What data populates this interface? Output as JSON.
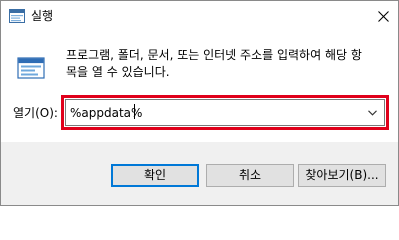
{
  "window": {
    "title": "실행",
    "app_icon": "run-dialog-icon",
    "close_icon": "close-icon"
  },
  "dialog": {
    "icon": "run-icon",
    "description_line1": "프로그램, 폴더, 문서, 또는 인터넷 주소를 입력하여 해당 항",
    "description_line2": "목을 열 수 있습니다.",
    "open_label": "열기(O):",
    "open_value": "%appdata%",
    "dropdown_icon": "chevron-down-icon",
    "highlight_color": "#e0001b"
  },
  "buttons": {
    "ok": "확인",
    "cancel": "취소",
    "browse": "찾아보기(B)..."
  },
  "colors": {
    "footer_bg": "#f0f0f0",
    "default_button_border": "#0078d7"
  }
}
